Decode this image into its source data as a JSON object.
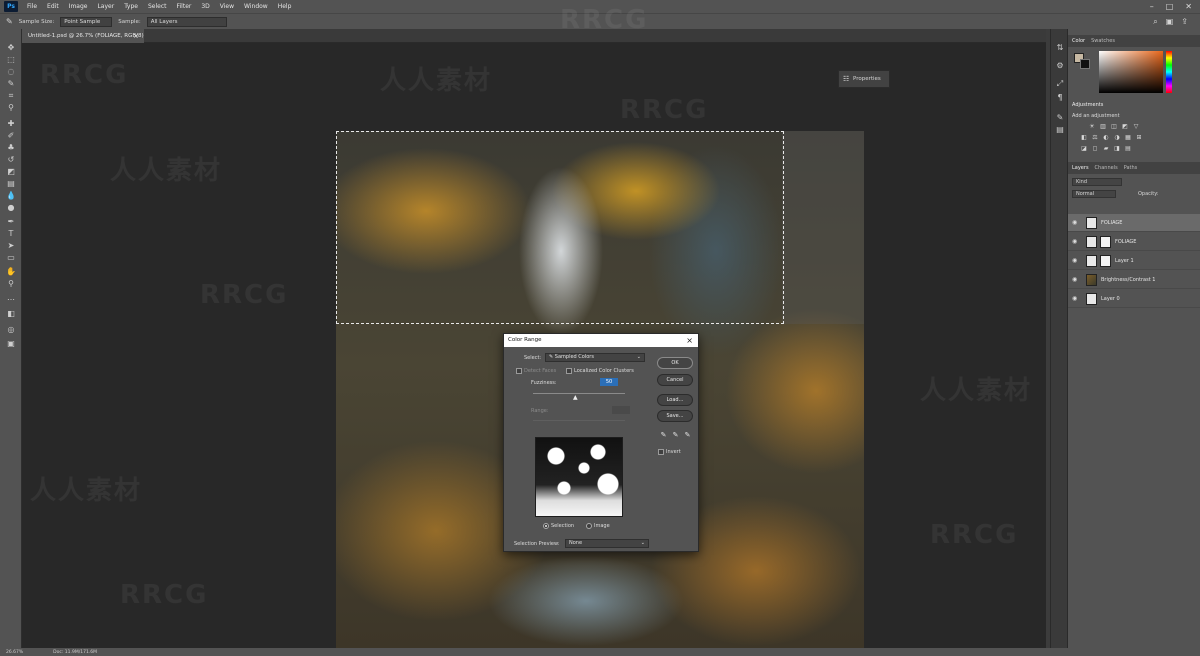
{
  "app": {
    "logo": "Ps",
    "menu": [
      "File",
      "Edit",
      "Image",
      "Layer",
      "Type",
      "Select",
      "Filter",
      "3D",
      "View",
      "Window",
      "Help"
    ],
    "window_controls": [
      "–",
      "□",
      "✕"
    ]
  },
  "options_bar": {
    "sample_size_label": "Sample Size:",
    "sample_size_value": "Point Sample",
    "sample_label": "Sample:",
    "sample_value": "All Layers"
  },
  "document": {
    "tab_title": "Untitled-1.psd @ 26.7% (FOLIAGE, RGB/8)",
    "zoom": "26.67%",
    "doc_info": "Doc: 11.9M/171.6M"
  },
  "properties_float": {
    "label": "Properties"
  },
  "color_panel": {
    "tabs": [
      "Color",
      "Swatches"
    ],
    "fg_color": "#c7b9a3",
    "bg_color": "#111111"
  },
  "adjustments_panel": {
    "title": "Adjustments",
    "subtitle": "Add an adjustment",
    "row1": [
      "☀",
      "▥",
      "◫",
      "◩",
      "▽"
    ],
    "row2": [
      "◧",
      "⚖",
      "◐",
      "◑",
      "▦",
      "⊞"
    ],
    "row3": [
      "◪",
      "◻",
      "▰",
      "◨",
      "▤"
    ]
  },
  "layers_panel": {
    "tabs": [
      "Layers",
      "Channels",
      "Paths"
    ],
    "kind_label": "Kind",
    "blend_mode": "Normal",
    "opacity_label": "Opacity:",
    "layers": [
      {
        "name": "FOLIAGE",
        "selected": true
      },
      {
        "name": "FOLIAGE",
        "selected": false
      },
      {
        "name": "Layer 1",
        "selected": false
      },
      {
        "name": "Brightness/Contrast 1",
        "selected": false
      },
      {
        "name": "Layer 0",
        "selected": false
      }
    ]
  },
  "dialog": {
    "title": "Color Range",
    "select_label": "Select:",
    "select_value": "Sampled Colors",
    "detect_faces_label": "Detect Faces",
    "localized_label": "Localized Color Clusters",
    "fuzziness_label": "Fuzziness:",
    "fuzziness_value": "50",
    "range_label": "Range:",
    "range_value": "",
    "selection_radio": "Selection",
    "image_radio": "Image",
    "preview_label": "Selection Preview:",
    "preview_value": "None",
    "buttons": {
      "ok": "OK",
      "cancel": "Cancel",
      "load": "Load...",
      "save": "Save..."
    },
    "invert_label": "Invert"
  },
  "watermarks": [
    "RRCG",
    "人人素材"
  ]
}
